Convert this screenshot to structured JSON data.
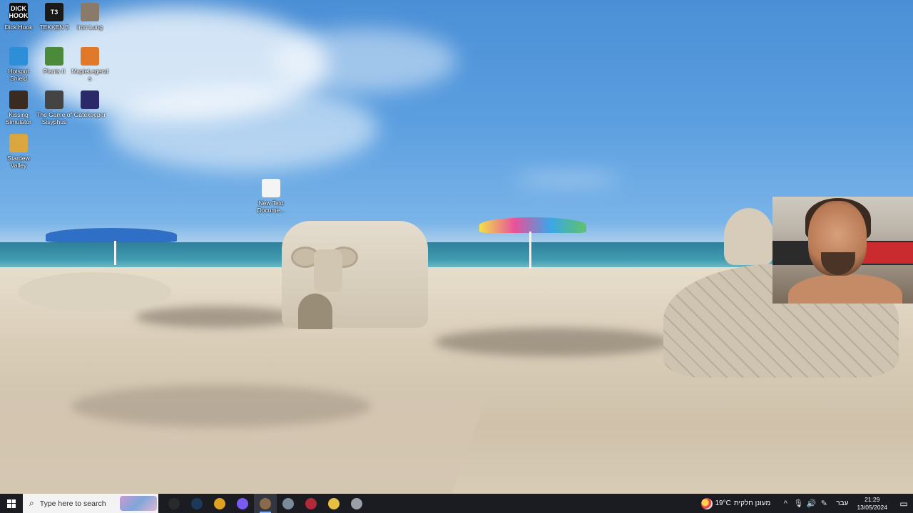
{
  "desktop": {
    "icons": [
      {
        "id": "dick-hook",
        "label": "Dick Hook",
        "glyph": "DICK\nHOOK",
        "bg": "#111111"
      },
      {
        "id": "tekken3",
        "label": "TEKKEN 3",
        "glyph": "T3",
        "bg": "#1a1a1a"
      },
      {
        "id": "iron-lung",
        "label": "Iron Lung",
        "glyph": "",
        "bg": "#8a7a6a"
      },
      {
        "id": "hotspot-shield",
        "label": "Hotspot Shield",
        "glyph": "",
        "bg": "#2c8fd8"
      },
      {
        "id": "plants",
        "label": "Plants II",
        "glyph": "",
        "bg": "#4a8a3a"
      },
      {
        "id": "maplelegends",
        "label": "MapleLegends",
        "glyph": "",
        "bg": "#e07a2a"
      },
      {
        "id": "kissing-simulator",
        "label": "Kissing Simulator",
        "glyph": "",
        "bg": "#3a2a20"
      },
      {
        "id": "game-of-sisyphus",
        "label": "The Game of Sisyphus",
        "glyph": "",
        "bg": "#444444"
      },
      {
        "id": "gatekeeper",
        "label": "Gatekeeper",
        "glyph": "",
        "bg": "#2a2a6a"
      },
      {
        "id": "stardew-valley",
        "label": "Stardew Valley",
        "glyph": "",
        "bg": "#d9a640"
      },
      {
        "id": "new-text-document",
        "label": "New Text Docume...",
        "glyph": "",
        "bg": "#f4f4f4"
      }
    ]
  },
  "taskbar": {
    "search_placeholder": "Type here to search",
    "apps": [
      {
        "id": "obs",
        "name": "obs-icon",
        "color": "#2a2a2a"
      },
      {
        "id": "steam",
        "name": "steam-icon",
        "color": "#1b3a5a"
      },
      {
        "id": "chrome",
        "name": "chrome-icon",
        "color": "#e0a020"
      },
      {
        "id": "discord",
        "name": "discord-icon",
        "color": "#7a5af0"
      },
      {
        "id": "game",
        "name": "game-icon",
        "color": "#8a6a4a",
        "active": true
      },
      {
        "id": "app6",
        "name": "window-icon",
        "color": "#7a8a9a"
      },
      {
        "id": "tekken",
        "name": "tekken-icon",
        "color": "#b02a3a"
      },
      {
        "id": "explorer",
        "name": "folder-icon",
        "color": "#e8c040"
      },
      {
        "id": "app9",
        "name": "shield-icon",
        "color": "#9aa0a8"
      }
    ],
    "weather_temp": "19°C",
    "weather_desc": "מעונן חלקית",
    "language": "עבר",
    "time": "21:29",
    "date": "13/05/2024"
  },
  "colors": {
    "taskbar_bg": "#1b1c22",
    "accent": "#7fb3ff"
  }
}
